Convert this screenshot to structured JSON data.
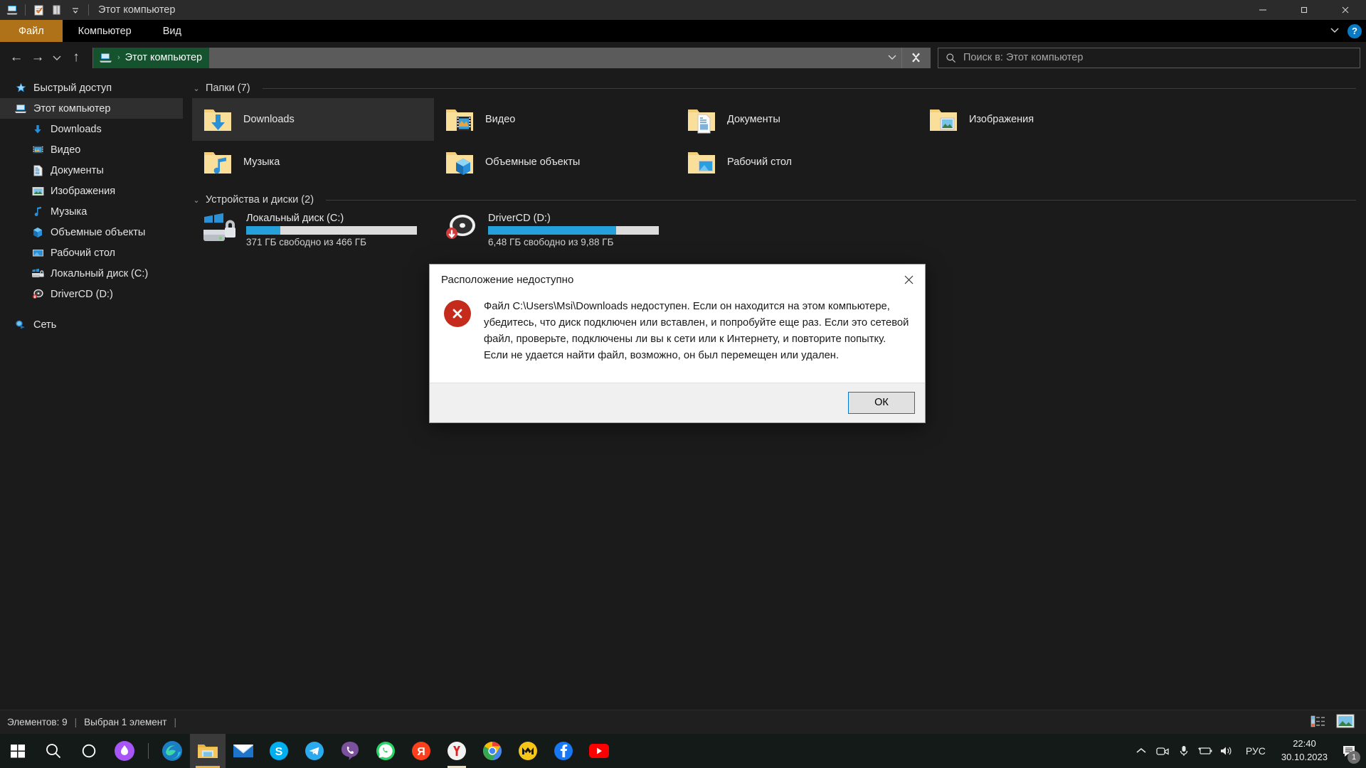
{
  "window": {
    "title": "Этот компьютер",
    "quick_access_icons": [
      "explorer-icon",
      "properties-icon",
      "new-folder-icon",
      "customize-chevron-icon"
    ],
    "controls": {
      "minimize": "—",
      "maximize": "❐",
      "close": "✕"
    }
  },
  "ribbon": {
    "tabs": [
      {
        "label": "Файл",
        "active_file": true
      },
      {
        "label": "Компьютер",
        "active_file": false
      },
      {
        "label": "Вид",
        "active_file": false
      }
    ],
    "expand_label": "⌄",
    "help_label": "?"
  },
  "addressbar": {
    "back": "←",
    "forward": "→",
    "recent": "⌄",
    "up": "↑",
    "crumb_label": "Этот компьютер",
    "crumb_separator": "›",
    "dropdown": "⌄",
    "refresh": "refresh-icon",
    "search_placeholder": "Поиск в: Этот компьютер"
  },
  "navpane": {
    "items": [
      {
        "label": "Быстрый доступ",
        "icon": "star-icon",
        "level": "root",
        "selected": false,
        "gap": false
      },
      {
        "label": "Этот компьютер",
        "icon": "computer-icon",
        "level": "root",
        "selected": true,
        "gap": false
      },
      {
        "label": "Downloads",
        "icon": "downloads-icon",
        "level": "child",
        "selected": false,
        "gap": false
      },
      {
        "label": "Видео",
        "icon": "videos-icon",
        "level": "child",
        "selected": false,
        "gap": false
      },
      {
        "label": "Документы",
        "icon": "documents-icon",
        "level": "child",
        "selected": false,
        "gap": false
      },
      {
        "label": "Изображения",
        "icon": "pictures-icon",
        "level": "child",
        "selected": false,
        "gap": false
      },
      {
        "label": "Музыка",
        "icon": "music-icon",
        "level": "child",
        "selected": false,
        "gap": false
      },
      {
        "label": "Объемные объекты",
        "icon": "3dobjects-icon",
        "level": "child",
        "selected": false,
        "gap": false
      },
      {
        "label": "Рабочий стол",
        "icon": "desktop-icon",
        "level": "child",
        "selected": false,
        "gap": false
      },
      {
        "label": "Локальный диск (C:)",
        "icon": "local-disk-icon",
        "level": "child",
        "selected": false,
        "gap": false
      },
      {
        "label": "DriverCD (D:)",
        "icon": "cd-drive-icon",
        "level": "child",
        "selected": false,
        "gap": false
      },
      {
        "label": "Сеть",
        "icon": "network-icon",
        "level": "root",
        "selected": false,
        "gap": true
      }
    ]
  },
  "content": {
    "groups": [
      {
        "title": "Папки (7)",
        "chevron": "⌄"
      },
      {
        "title": "Устройства и диски (2)",
        "chevron": "⌄"
      }
    ],
    "folders": [
      {
        "label": "Downloads",
        "icon": "folder-downloads-icon",
        "selected": true
      },
      {
        "label": "Видео",
        "icon": "folder-videos-icon",
        "selected": false
      },
      {
        "label": "Документы",
        "icon": "folder-documents-icon",
        "selected": false
      },
      {
        "label": "Изображения",
        "icon": "folder-pictures-icon",
        "selected": false
      },
      {
        "label": "Музыка",
        "icon": "folder-music-icon",
        "selected": false
      },
      {
        "label": "Объемные объекты",
        "icon": "folder-3dobjects-icon",
        "selected": false
      },
      {
        "label": "Рабочий стол",
        "icon": "folder-desktop-icon",
        "selected": false
      }
    ],
    "drives": [
      {
        "label": "Локальный диск (C:)",
        "icon": "windows-drive-icon",
        "used_percent": 20,
        "free_text": "371 ГБ свободно из 466 ГБ"
      },
      {
        "label": "DriverCD (D:)",
        "icon": "cd-drive-icon",
        "used_percent": 75,
        "free_text": "6,48 ГБ свободно из 9,88 ГБ"
      }
    ]
  },
  "statusbar": {
    "items_text": "Элементов: 9",
    "separator": "|",
    "selected_text": "Выбран 1 элемент",
    "trailing_separator": "|",
    "view_details_icon": "details-view-icon",
    "view_large_icons_icon": "large-icons-view-icon"
  },
  "dialog": {
    "title": "Расположение недоступно",
    "close": "✕",
    "error_icon": "error-icon",
    "message": "Файл C:\\Users\\Msi\\Downloads недоступен. Если он находится на этом компьютере, убедитесь, что диск подключен или вставлен, и попробуйте еще раз. Если это сетевой файл, проверьте, подключены ли вы к сети или к Интернету, и повторите попытку. Если не удается найти файл, возможно, он был перемещен или удален.",
    "ok_label": "ОК"
  },
  "taskbar": {
    "items": [
      {
        "name": "start-button",
        "icon": "windows-logo-icon",
        "active": false,
        "underline": false
      },
      {
        "name": "search-button",
        "icon": "search-icon",
        "active": false,
        "underline": false
      },
      {
        "name": "cortana-button",
        "icon": "cortana-circle-icon",
        "active": false,
        "underline": false
      },
      {
        "name": "alice-assistant-button",
        "icon": "alice-icon",
        "active": false,
        "underline": false
      },
      {
        "name": "separator",
        "icon": "separator",
        "active": false,
        "underline": false
      },
      {
        "name": "edge-button",
        "icon": "edge-icon",
        "active": false,
        "underline": false
      },
      {
        "name": "file-explorer-button",
        "icon": "file-explorer-icon",
        "active": true,
        "underline": false
      },
      {
        "name": "mail-button",
        "icon": "mail-icon",
        "active": false,
        "underline": false
      },
      {
        "name": "skype-button",
        "icon": "skype-icon",
        "active": false,
        "underline": false
      },
      {
        "name": "telegram-button",
        "icon": "telegram-icon",
        "active": false,
        "underline": false
      },
      {
        "name": "viber-button",
        "icon": "viber-icon",
        "active": false,
        "underline": false
      },
      {
        "name": "whatsapp-button",
        "icon": "whatsapp-icon",
        "active": false,
        "underline": false
      },
      {
        "name": "yandex-button",
        "icon": "yandex-ya-icon",
        "active": false,
        "underline": false
      },
      {
        "name": "yandex-browser-button",
        "icon": "yandex-browser-icon",
        "active": false,
        "underline": true
      },
      {
        "name": "chrome-button",
        "icon": "chrome-icon",
        "active": false,
        "underline": false
      },
      {
        "name": "mega-button",
        "icon": "mega-icon",
        "active": false,
        "underline": false
      },
      {
        "name": "facebook-button",
        "icon": "facebook-icon",
        "active": false,
        "underline": false
      },
      {
        "name": "youtube-button",
        "icon": "youtube-icon",
        "active": false,
        "underline": false
      }
    ],
    "tray": {
      "show_hidden": "⌃",
      "icons": [
        "camera-icon",
        "microphone-icon",
        "battery-icon",
        "volume-icon"
      ],
      "language": "РУС",
      "time": "22:40",
      "date": "30.10.2023",
      "notification_count": "1"
    }
  }
}
